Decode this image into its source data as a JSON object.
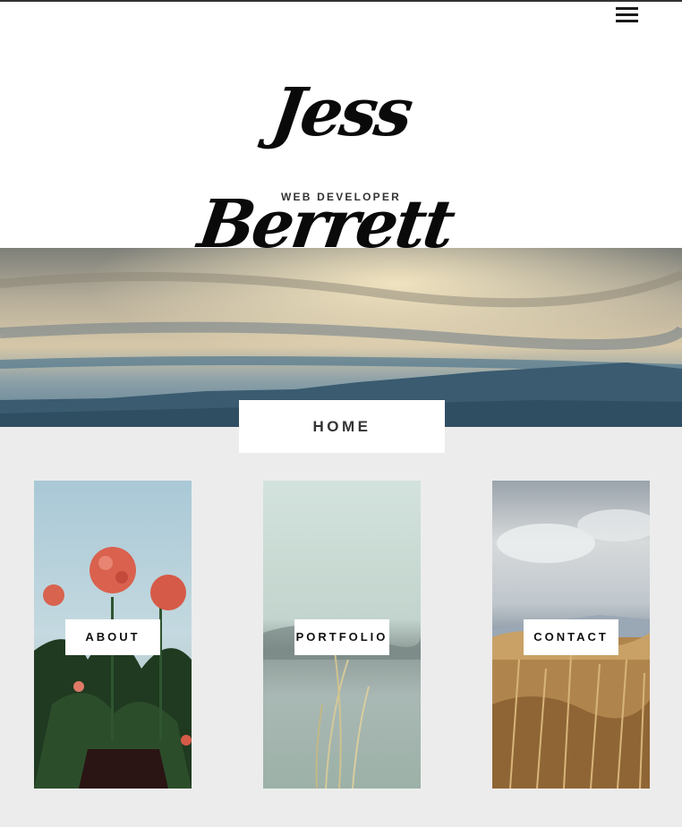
{
  "site": {
    "logo_text": "Jess Berrett",
    "subtitle": "WEB DEVELOPER"
  },
  "nav": {
    "menu_icon": "hamburger-menu-icon"
  },
  "hero": {
    "page_label": "HOME"
  },
  "cards": [
    {
      "label": "ABOUT",
      "image": "red-geranium-flowers-photo"
    },
    {
      "label": "PORTFOLIO",
      "image": "misty-grass-photo"
    },
    {
      "label": "CONTACT",
      "image": "golden-reeds-field-photo"
    }
  ],
  "colors": {
    "background": "#ececec",
    "text": "#333333",
    "panel": "#ffffff"
  }
}
